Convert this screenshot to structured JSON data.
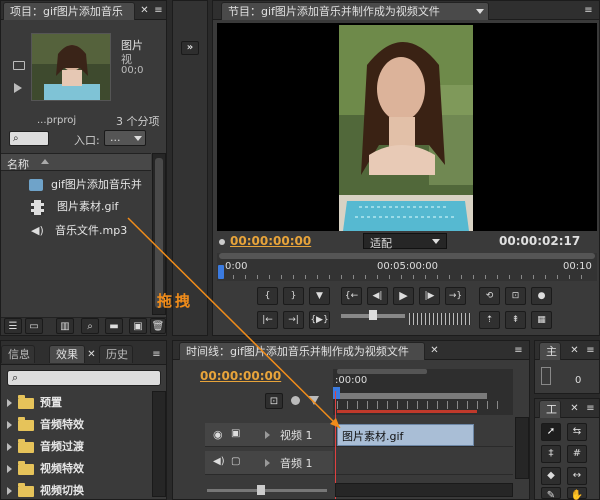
{
  "project_panel": {
    "tab_label": "项目：gif图片添加音乐",
    "preview_name": "图片",
    "preview_line2": "视",
    "preview_line3": "00;0",
    "project_file": "...prproj",
    "item_count": "3 个分项",
    "entry_label": "入口:",
    "entry_value": "...",
    "name_header": "名称",
    "items": [
      {
        "label": "gif图片添加音乐并"
      },
      {
        "label": "图片素材.gif"
      },
      {
        "label": "音乐文件.mp3"
      }
    ]
  },
  "program_monitor": {
    "tab_label": "节目：gif图片添加音乐并制作成为视频文件",
    "timecode_current": "00:00:00:00",
    "fit_label": "适配",
    "timecode_duration": "00:00:02:17",
    "ruler_start": "0:00",
    "ruler_mid": "00:05:00:00",
    "ruler_end": "00:10"
  },
  "annotation": {
    "drag_label": "拖拽"
  },
  "effects_panel": {
    "tabs": [
      {
        "label": "信息"
      },
      {
        "label": "效果"
      },
      {
        "label": "历史"
      }
    ],
    "items": [
      {
        "label": "预置"
      },
      {
        "label": "音频特效"
      },
      {
        "label": "音频过渡"
      },
      {
        "label": "视频特效"
      },
      {
        "label": "视频切换"
      }
    ]
  },
  "timeline_panel": {
    "tab_label": "时间线：gif图片添加音乐并制作成为视频文件",
    "timecode": "00:00:00:00",
    "ruler_start": ":00:00",
    "video_track_label": "视频 1",
    "audio_track_label": "音频 1",
    "clip_label": "图片素材.gif"
  },
  "right_panel": {
    "tab_label": "主",
    "zero": "0",
    "tools_label": "工"
  },
  "colors": {
    "timecode_orange": "#e8a43a",
    "accent_blue": "#3b7be0",
    "clip_blue": "#a9bed6",
    "annotation_orange": "#f08c1a"
  }
}
